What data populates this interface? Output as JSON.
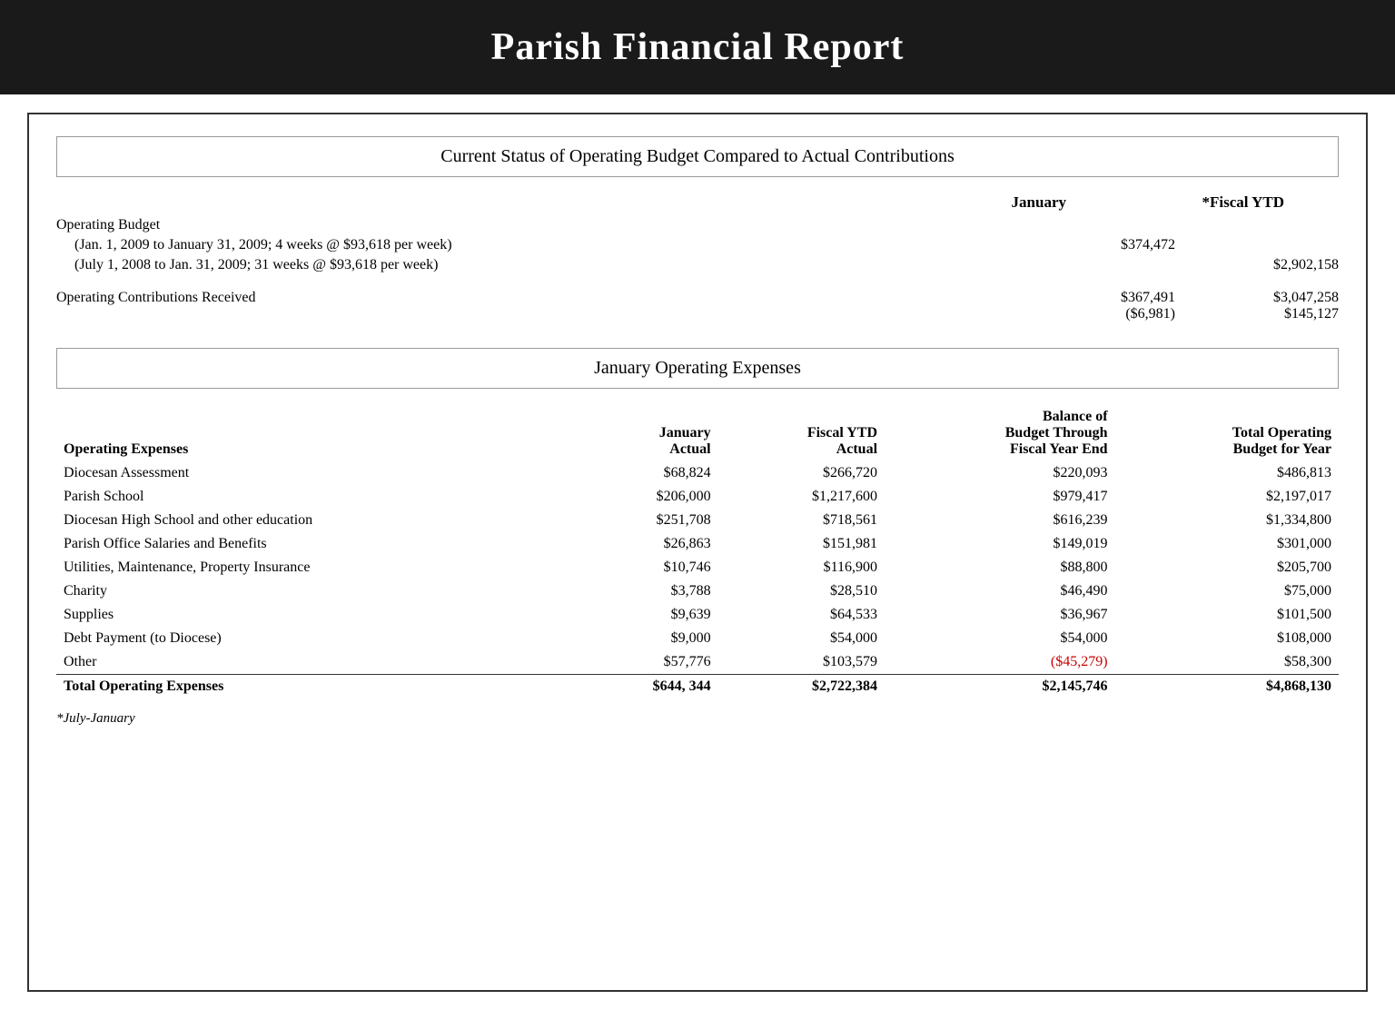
{
  "header": {
    "title": "Parish Financial Report"
  },
  "top_section": {
    "title": "Current Status of Operating Budget Compared to Actual Contributions",
    "col_headers": [
      "January",
      "*Fiscal YTD"
    ],
    "rows": [
      {
        "label": "Operating Budget",
        "indent": false,
        "jan": "",
        "ytd": ""
      },
      {
        "label": "(Jan. 1, 2009 to January 31, 2009; 4 weeks @ $93,618 per week)",
        "indent": true,
        "jan": "$374,472",
        "ytd": ""
      },
      {
        "label": "(July 1, 2008 to Jan. 31, 2009; 31 weeks @ $93,618 per week)",
        "indent": true,
        "jan": "",
        "ytd": "$2,902,158"
      },
      {
        "label": "Operating Contributions Received",
        "indent": false,
        "jan": "$367,491",
        "jan2": "($6,981)",
        "ytd": "$3,047,258",
        "ytd2": "$145,127"
      }
    ]
  },
  "bottom_section": {
    "title": "January Operating Expenses",
    "col_headers": {
      "label": "Operating Expenses",
      "jan": "January\nActual",
      "ytd": "Fiscal YTD\nActual",
      "balance": "Balance of\nBudget Through\nFiscal Year End",
      "total": "Total Operating\nBudget for Year"
    },
    "rows": [
      {
        "label": "Diocesan Assessment",
        "jan": "$68,824",
        "ytd": "$266,720",
        "balance": "$220,093",
        "total": "$486,813",
        "balance_red": false
      },
      {
        "label": "Parish School",
        "jan": "$206,000",
        "ytd": "$1,217,600",
        "balance": "$979,417",
        "total": "$2,197,017",
        "balance_red": false
      },
      {
        "label": "Diocesan High School and other education",
        "jan": "$251,708",
        "ytd": "$718,561",
        "balance": "$616,239",
        "total": "$1,334,800",
        "balance_red": false
      },
      {
        "label": "Parish Office Salaries and Benefits",
        "jan": "$26,863",
        "ytd": "$151,981",
        "balance": "$149,019",
        "total": "$301,000",
        "balance_red": false
      },
      {
        "label": "Utilities, Maintenance, Property Insurance",
        "jan": "$10,746",
        "ytd": "$116,900",
        "balance": "$88,800",
        "total": "$205,700",
        "balance_red": false
      },
      {
        "label": "Charity",
        "jan": "$3,788",
        "ytd": "$28,510",
        "balance": "$46,490",
        "total": "$75,000",
        "balance_red": false
      },
      {
        "label": "Supplies",
        "jan": "$9,639",
        "ytd": "$64,533",
        "balance": "$36,967",
        "total": "$101,500",
        "balance_red": false
      },
      {
        "label": "Debt Payment (to Diocese)",
        "jan": "$9,000",
        "ytd": "$54,000",
        "balance": "$54,000",
        "total": "$108,000",
        "balance_red": false
      },
      {
        "label": "Other",
        "jan": "$57,776",
        "ytd": "$103,579",
        "balance": "($45,279)",
        "total": "$58,300",
        "balance_red": true
      }
    ],
    "total_row": {
      "label": "Total Operating Expenses",
      "jan": "$644, 344",
      "ytd": "$2,722,384",
      "balance": "$2,145,746",
      "total": "$4,868,130"
    },
    "footnote": "*July-January"
  }
}
